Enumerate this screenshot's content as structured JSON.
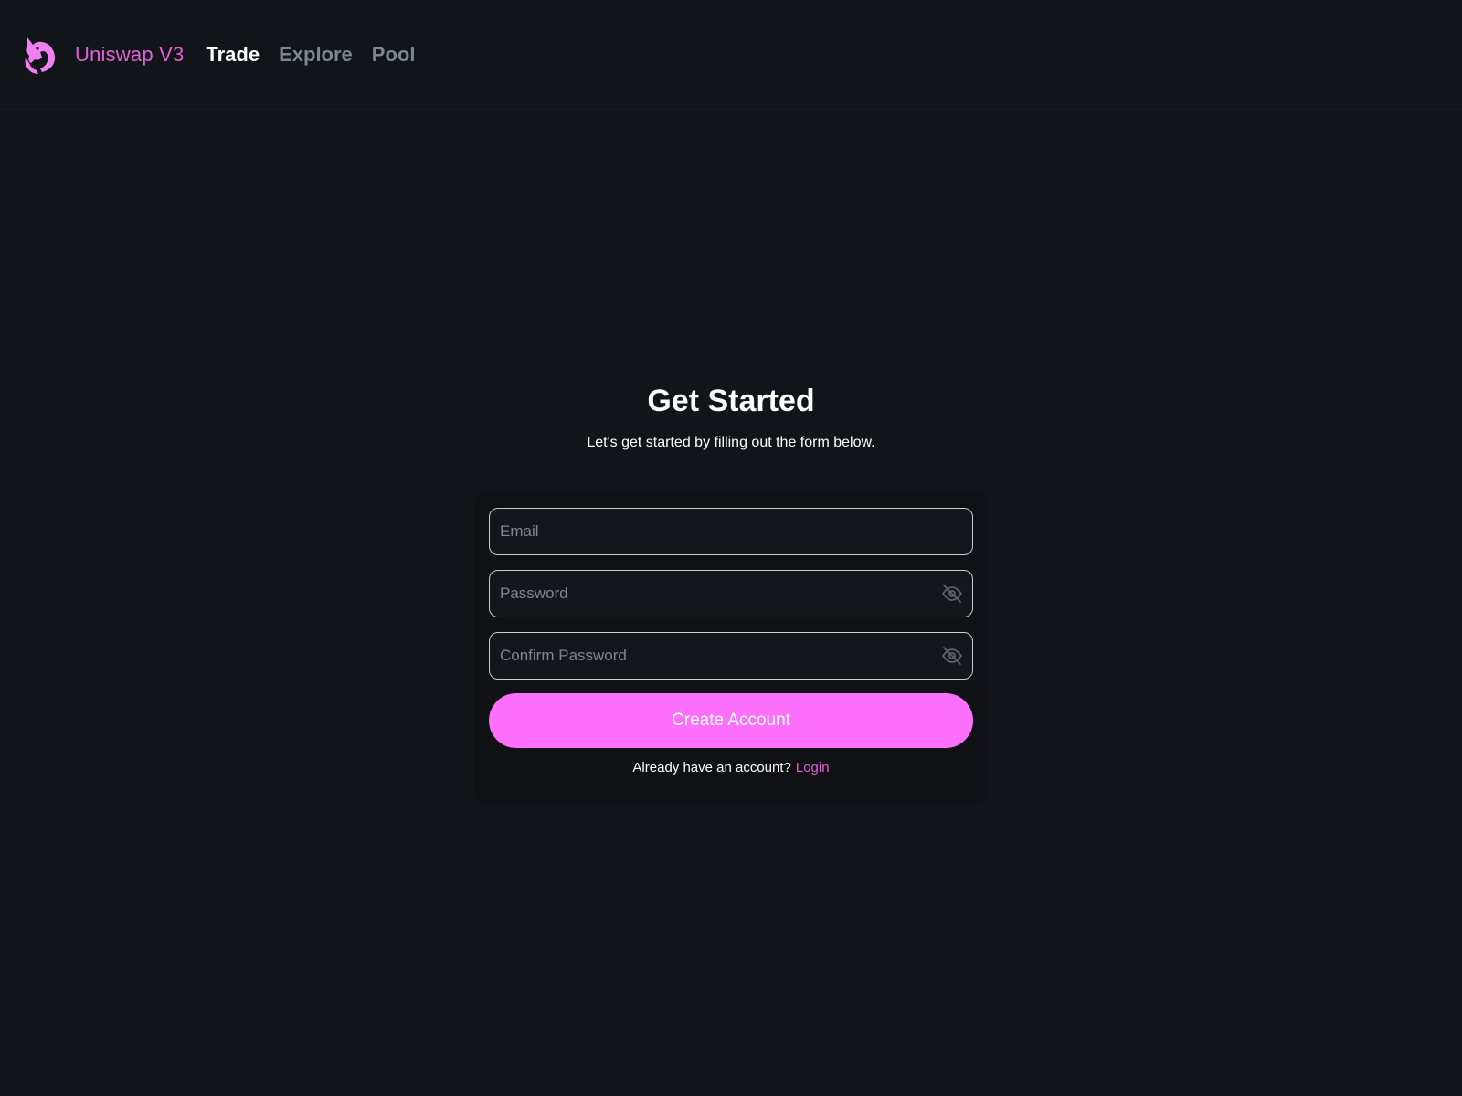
{
  "header": {
    "brand": "Uniswap V3",
    "logo_icon": "unicorn-logo-icon",
    "nav": [
      {
        "label": "Trade",
        "active": true
      },
      {
        "label": "Explore",
        "active": false
      },
      {
        "label": "Pool",
        "active": false
      }
    ]
  },
  "main": {
    "title": "Get Started",
    "subtitle": "Let's get started by filling out the form below."
  },
  "form": {
    "email": {
      "value": "",
      "placeholder": "Email"
    },
    "password": {
      "value": "",
      "placeholder": "Password",
      "toggle_icon": "eye-off-icon"
    },
    "confirm_password": {
      "value": "",
      "placeholder": "Confirm Password",
      "toggle_icon": "eye-off-icon"
    },
    "submit_label": "Create Account",
    "footer_text": "Already have an account?",
    "login_label": "Login"
  },
  "colors": {
    "background": "#111519",
    "accent": "#fd6ffd",
    "brand": "#e35fd5",
    "muted": "#7d8590"
  }
}
